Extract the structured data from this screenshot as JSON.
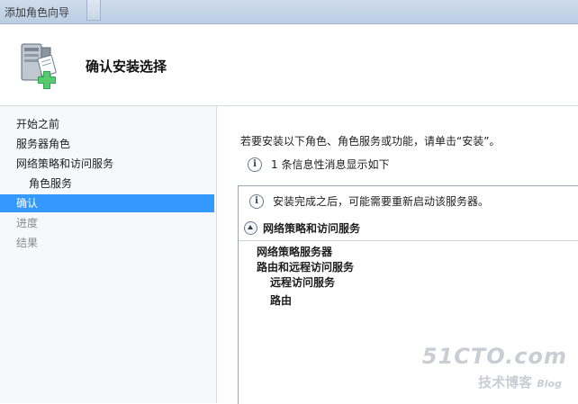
{
  "window": {
    "title": "添加角色向导"
  },
  "header": {
    "title": "确认安装选择",
    "icon": "server-add-icon"
  },
  "sidebar": {
    "items": [
      {
        "label": "开始之前",
        "state": "normal"
      },
      {
        "label": "服务器角色",
        "state": "normal"
      },
      {
        "label": "网络策略和访问服务",
        "state": "normal"
      },
      {
        "label": "角色服务",
        "state": "sub"
      },
      {
        "label": "确认",
        "state": "active"
      },
      {
        "label": "进度",
        "state": "disabled"
      },
      {
        "label": "结果",
        "state": "disabled"
      }
    ]
  },
  "main": {
    "instruction": "若要安装以下角色、角色服务或功能，请单击“安装”。",
    "info_count": "1 条信息性消息显示如下",
    "notice": "安装完成之后，可能需要重新启动该服务器。",
    "group_title": "网络策略和访问服务",
    "items": [
      "网络策略服务器",
      "路由和远程访问服务",
      "远程访问服务",
      "路由"
    ]
  },
  "watermark": {
    "line1": "51CTO.com",
    "line2": "技术博客",
    "line3": "Blog"
  },
  "colors": {
    "accent": "#3399ff",
    "sidebar_bg": "#f6f8fb",
    "titlebar": "#c7d5e7"
  }
}
